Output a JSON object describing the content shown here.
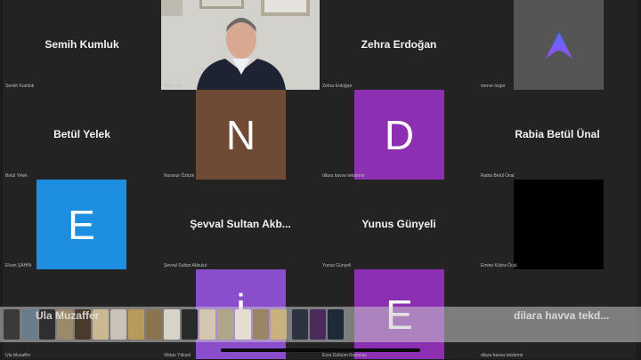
{
  "participants": [
    {
      "display": "Semih Kumluk",
      "label": "Semih Kumluk"
    },
    {
      "display": "",
      "label": "Hilal Örgi"
    },
    {
      "display": "Zehra Erdoğan",
      "label": "Zehra Erdoğan"
    },
    {
      "display": "",
      "label": "merve özger",
      "logo": "arch-logo-icon"
    },
    {
      "display": "Betül Yelek",
      "label": "Betül Yelek"
    },
    {
      "display": "N",
      "label": "Nuranur Öztürk",
      "color": "#6f4a35"
    },
    {
      "display": "D",
      "label": "dilara havva tekdemir",
      "color": "#8d2fb3"
    },
    {
      "display": "Rabia Betül Ünal",
      "label": "Rabia Betül Ünal"
    },
    {
      "display": "E",
      "label": "Elvan ŞAHİN",
      "color": "#1e8fe0"
    },
    {
      "display": "Şevval Sultan Akb...",
      "label": "Şevval Sultan Akbulut"
    },
    {
      "display": "Yunus Günyeli",
      "label": "Yunus Günyeli"
    },
    {
      "display": "",
      "label": "Emine Kübra Öcal",
      "color": "#000000"
    },
    {
      "display": "Ula Muzaffer",
      "label": "Ula Muzaffer"
    },
    {
      "display": "İ",
      "label": "Vildan Yüksel",
      "color": "#8a4dcc"
    },
    {
      "display": "E",
      "label": "Esra Gülsüm Korkmaz",
      "color": "#8d2fb3"
    },
    {
      "display": "dilara havva tekd...",
      "label": "dilara havva tekdemir"
    }
  ],
  "thumbnail_strip": {
    "label": "app switcher thumbnails"
  }
}
